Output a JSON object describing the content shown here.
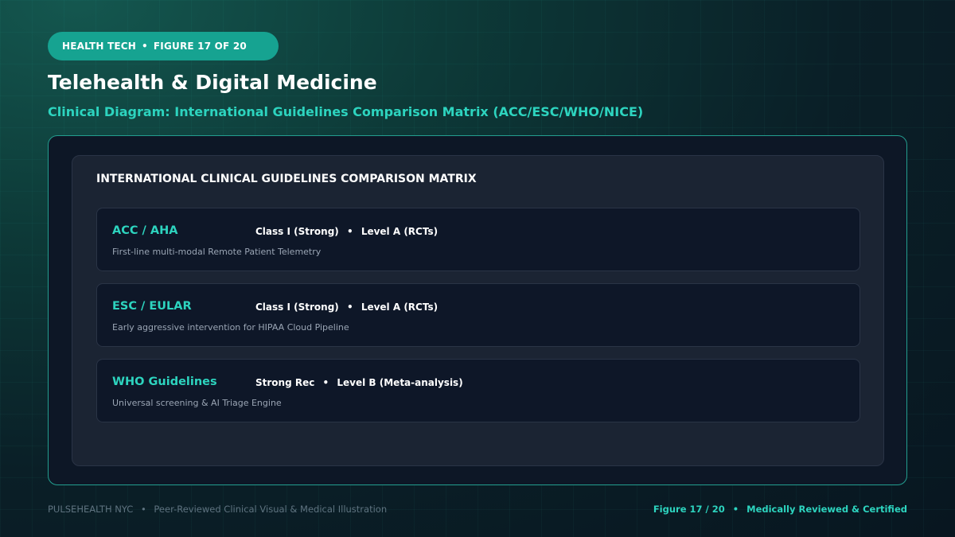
{
  "header": {
    "category": "HEALTH TECH",
    "figure": "FIGURE 17 OF 20",
    "title": "Telehealth & Digital Medicine",
    "subtitle": "Clinical Diagram: International Guidelines Comparison Matrix (ACC/ESC/WHO/NICE)"
  },
  "matrix": {
    "title": "INTERNATIONAL CLINICAL GUIDELINES COMPARISON MATRIX",
    "rows": [
      {
        "org": "ACC / AHA",
        "strength": "Class I (Strong)",
        "evidence": "Level A (RCTs)",
        "description": "First-line multi-modal Remote Patient Telemetry"
      },
      {
        "org": "ESC / EULAR",
        "strength": "Class I (Strong)",
        "evidence": "Level A (RCTs)",
        "description": "Early aggressive intervention for HIPAA Cloud Pipeline"
      },
      {
        "org": "WHO Guidelines",
        "strength": "Strong Rec",
        "evidence": "Level B (Meta-analysis)",
        "description": "Universal screening & AI Triage Engine"
      }
    ]
  },
  "footer": {
    "brand": "PULSEHEALTH NYC",
    "tagline": "Peer-Reviewed Clinical Visual & Medical Illustration",
    "figure": "Figure 17 / 20",
    "certification": "Medically Reviewed & Certified"
  },
  "separator": "•",
  "colors": {
    "accent": "#2dd4bf",
    "pill": "#16a391",
    "panel": "#1b2433",
    "row": "#0e1728"
  }
}
